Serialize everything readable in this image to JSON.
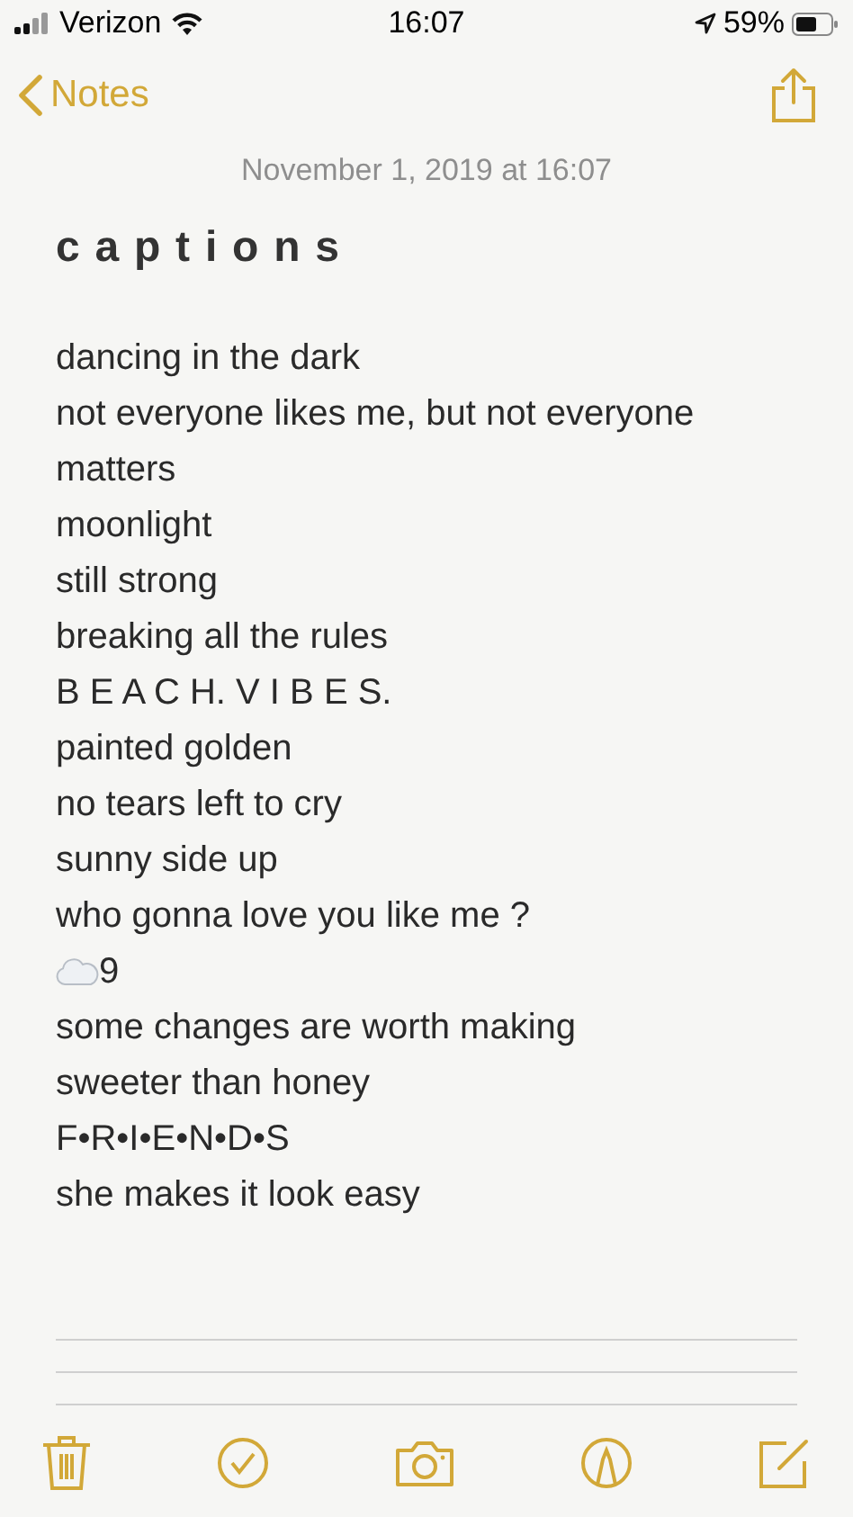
{
  "status_bar": {
    "carrier": "Verizon",
    "time": "16:07",
    "battery": "59%"
  },
  "nav": {
    "back": "Notes"
  },
  "note": {
    "date": "November 1, 2019 at 16:07",
    "title": "captions",
    "lines": [
      {
        "kind": "text",
        "text": "dancing in the dark"
      },
      {
        "kind": "text",
        "text": "not everyone likes me, but not everyone matters"
      },
      {
        "kind": "text",
        "text": "moonlight"
      },
      {
        "kind": "text",
        "text": "still strong"
      },
      {
        "kind": "text",
        "text": "breaking all the rules"
      },
      {
        "kind": "text",
        "text": "B E A C H. V I B E S."
      },
      {
        "kind": "text",
        "text": "painted golden"
      },
      {
        "kind": "text",
        "text": "no tears left to cry"
      },
      {
        "kind": "text",
        "text": "sunny side up"
      },
      {
        "kind": "text",
        "text": "who gonna love you like me ?"
      },
      {
        "kind": "cloud",
        "text": "9"
      },
      {
        "kind": "text",
        "text": "some changes are worth making"
      },
      {
        "kind": "text",
        "text": "sweeter than honey"
      },
      {
        "kind": "text",
        "text": "F•R•I•E•N•D•S"
      },
      {
        "kind": "text",
        "text": "she makes it look easy"
      }
    ]
  }
}
